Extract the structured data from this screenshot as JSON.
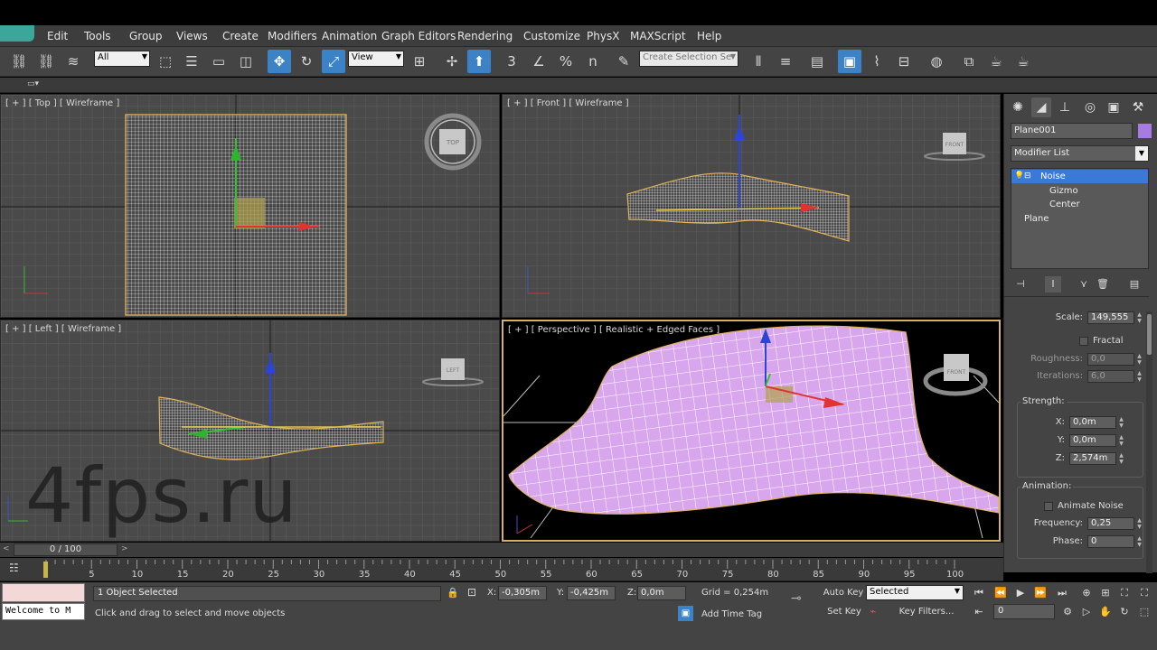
{
  "menu": [
    "Edit",
    "Tools",
    "Group",
    "Views",
    "Create",
    "Modifiers",
    "Animation",
    "Graph Editors",
    "Rendering",
    "Customize",
    "PhysX",
    "MAXScript",
    "Help"
  ],
  "toolbar": {
    "filter_value": "All",
    "ref_coord_value": "View",
    "selection_set_placeholder": "Create Selection Se",
    "snap_3_label": "3",
    "snap_percent_label": "%",
    "spinner_snap_label": "n"
  },
  "viewports": {
    "top": {
      "label": "[ + ] [ Top ] [ Wireframe ]",
      "cube_label": "TOP"
    },
    "front": {
      "label": "[ + ] [ Front ] [ Wireframe ]",
      "cube_label": "FRONT"
    },
    "left": {
      "label": "[ + ] [ Left ] [ Wireframe ]",
      "cube_label": "LEFT"
    },
    "perspective": {
      "label": "[ + ] [ Perspective ] [ Realistic + Edged Faces ]",
      "cube_label": "FRONT"
    }
  },
  "command_panel": {
    "object_name": "Plane001",
    "object_color": "#a77be0",
    "modifier_list_label": "Modifier List",
    "stack": [
      {
        "label": "Noise",
        "selected": true
      },
      {
        "label": "Gizmo",
        "selected": false
      },
      {
        "label": "Center",
        "selected": false
      },
      {
        "label": "Plane",
        "selected": false
      }
    ],
    "params": {
      "scale_label": "Scale:",
      "scale_value": "149,555",
      "fractal_label": "Fractal",
      "roughness_label": "Roughness:",
      "roughness_value": "0,0",
      "iterations_label": "Iterations:",
      "iterations_value": "6,0",
      "strength_title": "Strength:",
      "x_label": "X:",
      "x_value": "0,0m",
      "y_label": "Y:",
      "y_value": "0,0m",
      "z_label": "Z:",
      "z_value": "2,574m",
      "animation_title": "Animation:",
      "animate_noise_label": "Animate Noise",
      "frequency_label": "Frequency:",
      "frequency_value": "0,25",
      "phase_label": "Phase:",
      "phase_value": "0"
    }
  },
  "timeline": {
    "slider_label": "0 / 100",
    "ticks": [
      "5",
      "10",
      "15",
      "20",
      "25",
      "30",
      "35",
      "40",
      "45",
      "50",
      "55",
      "60",
      "65",
      "70",
      "75",
      "80",
      "85",
      "90",
      "95",
      "100"
    ]
  },
  "status": {
    "listener_text": "Welcome to M",
    "selection_status": "1 Object Selected",
    "prompt": "Click and drag to select and move objects",
    "x_label": "X:",
    "x_value": "-0,305m",
    "y_label": "Y:",
    "y_value": "-0,425m",
    "z_label": "Z:",
    "z_value": "0,0m",
    "grid": "Grid = 0,254m",
    "add_time_tag": "Add Time Tag",
    "auto_key": "Auto Key",
    "set_key": "Set Key",
    "key_mode": "Selected",
    "key_filters": "Key Filters...",
    "current_frame": "0"
  },
  "watermark": "4fps.ru",
  "colors": {
    "accent": "#3b82c6",
    "selection_highlight": "#3a79d8",
    "active_viewport_border": "#d7b35e",
    "mesh_shaded": "#d8a6ec"
  }
}
